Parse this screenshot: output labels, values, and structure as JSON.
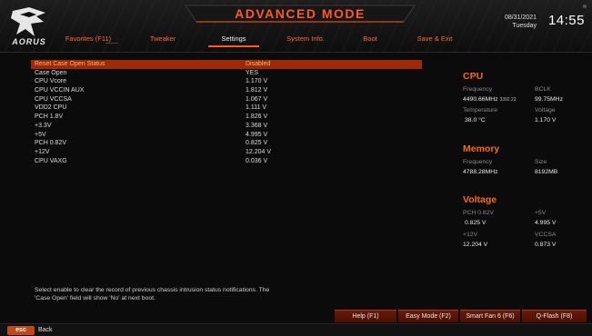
{
  "header": {
    "title": "ADVANCED MODE",
    "brand": "AORUS",
    "date": "08/31/2021",
    "weekday": "Tuesday",
    "time": "14:55",
    "tabs": [
      {
        "label": "Favorites (F11)",
        "active": false
      },
      {
        "label": "Tweaker",
        "active": false
      },
      {
        "label": "Settings",
        "active": true
      },
      {
        "label": "System Info.",
        "active": false
      },
      {
        "label": "Boot",
        "active": false
      },
      {
        "label": "Save & Exit",
        "active": false
      }
    ]
  },
  "settings": {
    "rows": [
      {
        "label": "Reset Case Open Status",
        "value": "Disabled",
        "selected": true
      },
      {
        "label": "Case Open",
        "value": "YES"
      },
      {
        "label": "CPU Vcore",
        "value": "1.170 V"
      },
      {
        "label": "CPU VCCIN AUX",
        "value": "1.812 V"
      },
      {
        "label": "CPU VCCSA",
        "value": "1.067 V"
      },
      {
        "label": "VDD2 CPU",
        "value": "1.111 V"
      },
      {
        "label": "PCH 1.8V",
        "value": "1.826 V"
      },
      {
        "label": "+3.3V",
        "value": "3.368 V"
      },
      {
        "label": "+5V",
        "value": "4.995 V"
      },
      {
        "label": "PCH 0.82V",
        "value": "0.825 V"
      },
      {
        "label": "+12V",
        "value": "12.204 V"
      },
      {
        "label": "CPU VAXG",
        "value": "0.036 V"
      }
    ]
  },
  "info": {
    "cpu": {
      "heading": "CPU",
      "frequency_label": "Frequency",
      "frequency_value": "4490.66MHz",
      "frequency_sub": "3392.22",
      "bclk_label": "BCLK",
      "bclk_value": "99.75MHz",
      "temperature_label": "Temperature",
      "temperature_value": "38.0 °C",
      "voltage_label": "Voltage",
      "voltage_value": "1.170 V"
    },
    "memory": {
      "heading": "Memory",
      "frequency_label": "Frequency",
      "frequency_value": "4788.28MHz",
      "size_label": "Size",
      "size_value": "8192MB"
    },
    "voltage": {
      "heading": "Voltage",
      "pch_label": "PCH 0.82V",
      "pch_value": "0.825 V",
      "p5v_label": "+5V",
      "p5v_value": "4.995 V",
      "p12v_label": "+12V",
      "p12v_value": "12.204 V",
      "vccsa_label": "VCCSA",
      "vccsa_value": "0.873 V"
    }
  },
  "help": {
    "line1": "Select enable to clear the record of previous chassis intrusion status notifications. The",
    "line2": "'Case Open' field will show 'No' at next boot."
  },
  "footer": {
    "esc_key": "esc",
    "back_label": "Back",
    "buttons": [
      "Help (F1)",
      "Easy Mode (F2)",
      "Smart Fan 6 (F6)",
      "Q-Flash (F8)"
    ]
  },
  "colors": {
    "accent": "#ff5a1f",
    "selected_row": "#9c2a06",
    "heading": "#ff6a00"
  }
}
